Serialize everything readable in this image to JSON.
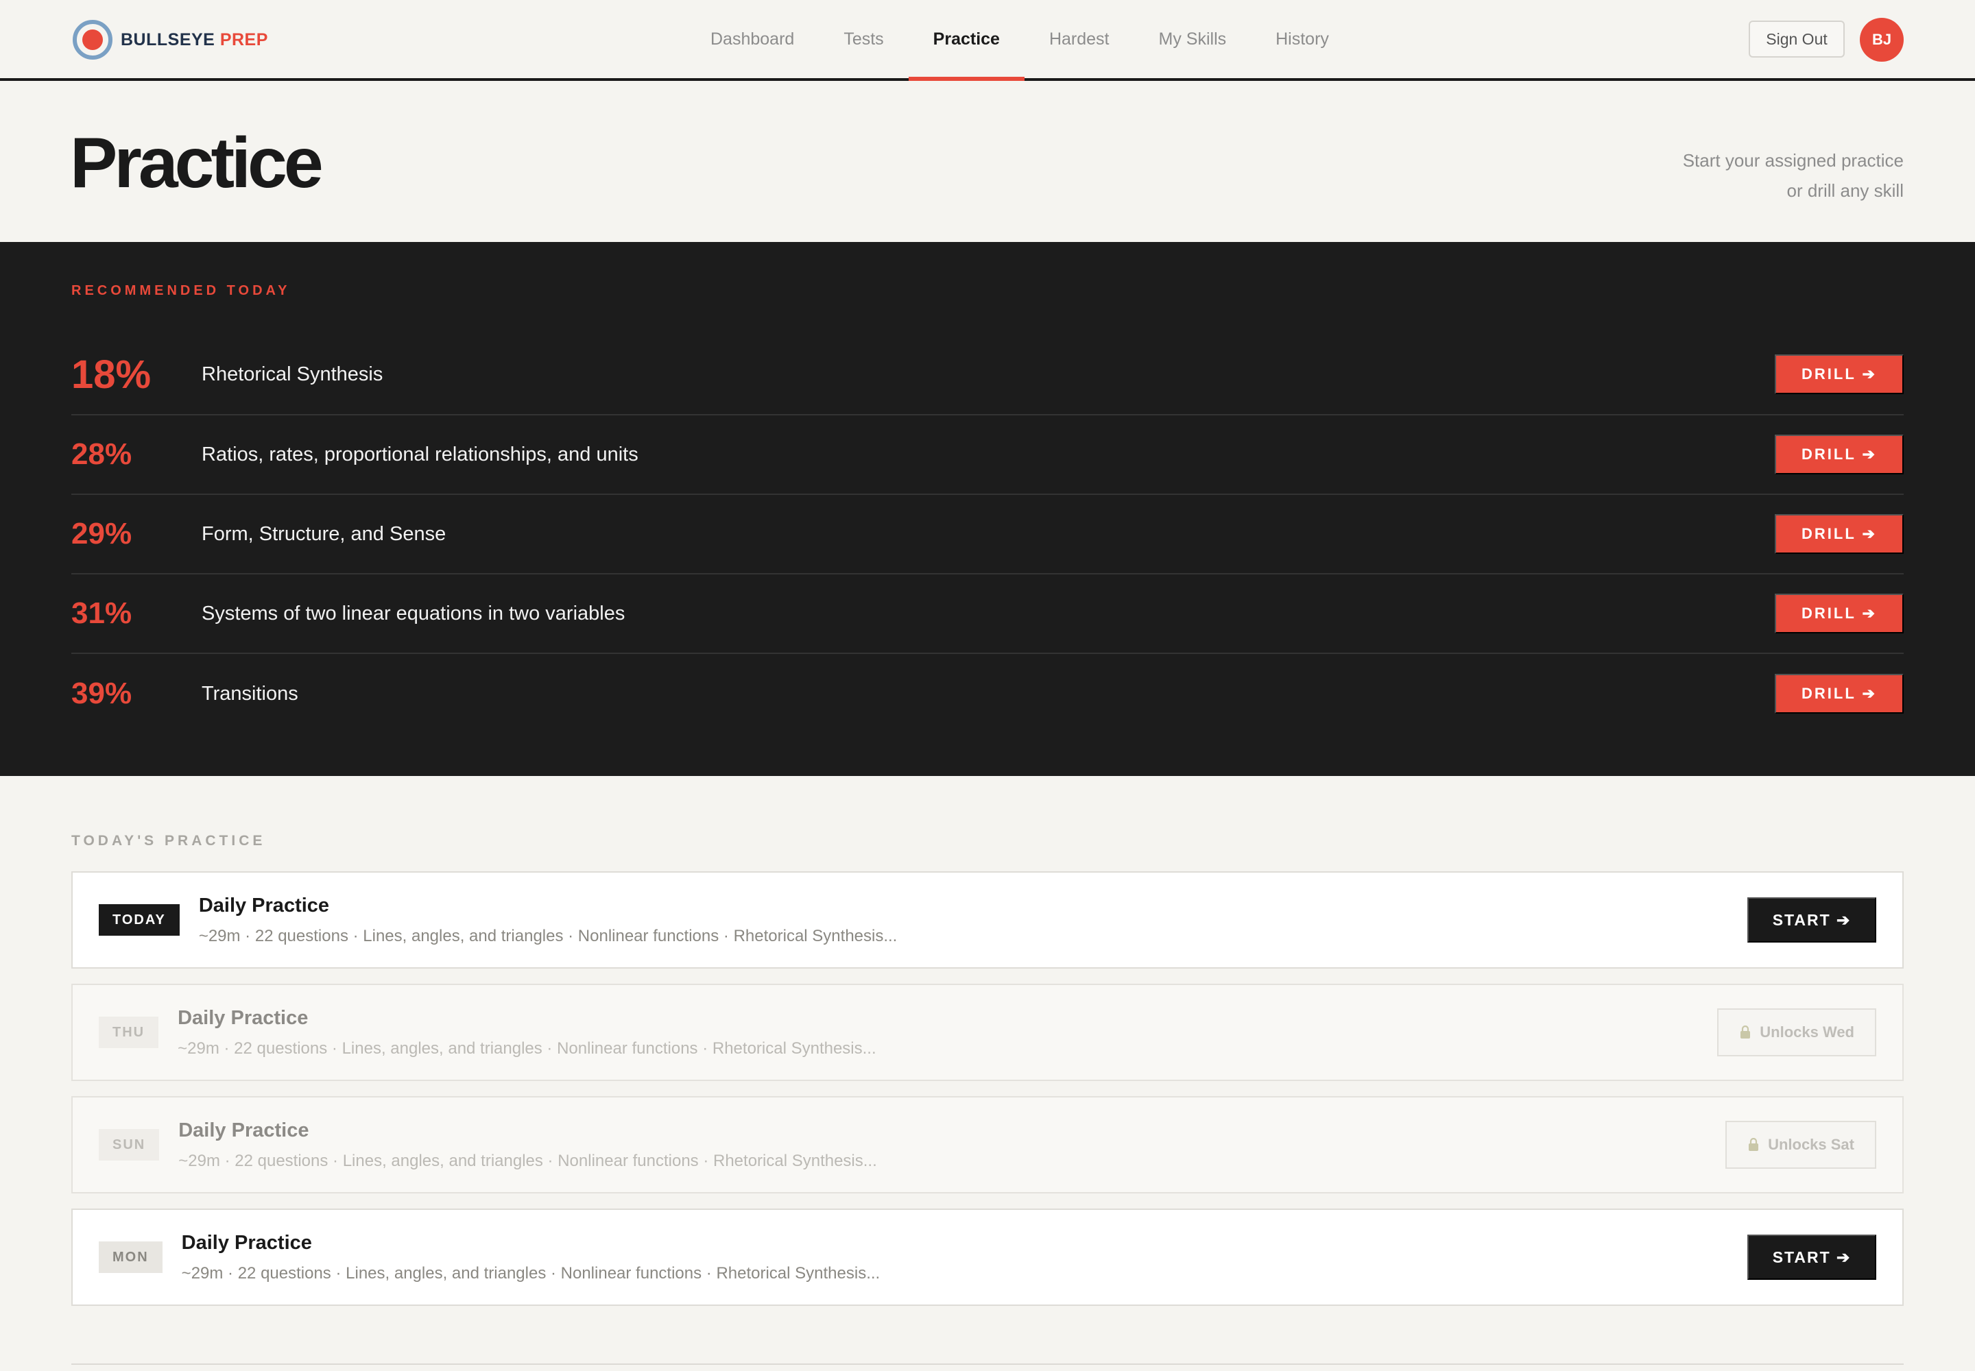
{
  "header": {
    "logo": {
      "part1": "BULLSEYE",
      "part2": "PREP",
      "icon": "bullseye-icon"
    },
    "nav": [
      {
        "label": "Dashboard",
        "active": false
      },
      {
        "label": "Tests",
        "active": false
      },
      {
        "label": "Practice",
        "active": true
      },
      {
        "label": "Hardest",
        "active": false
      },
      {
        "label": "My Skills",
        "active": false
      },
      {
        "label": "History",
        "active": false
      }
    ],
    "sign_out_label": "Sign Out",
    "avatar_initials": "BJ"
  },
  "page": {
    "title": "Practice",
    "subtitle_line1": "Start your assigned practice",
    "subtitle_line2": "or drill any skill"
  },
  "recommended": {
    "label": "RECOMMENDED TODAY",
    "items": [
      {
        "pct": "18%",
        "skill": "Rhetorical Synthesis",
        "button": "DRILL ➔"
      },
      {
        "pct": "28%",
        "skill": "Ratios, rates, proportional relationships, and units",
        "button": "DRILL ➔"
      },
      {
        "pct": "29%",
        "skill": "Form, Structure, and Sense",
        "button": "DRILL ➔"
      },
      {
        "pct": "31%",
        "skill": "Systems of two linear equations in two variables",
        "button": "DRILL ➔"
      },
      {
        "pct": "39%",
        "skill": "Transitions",
        "button": "DRILL ➔"
      }
    ]
  },
  "todays_practice": {
    "label": "TODAY'S PRACTICE",
    "cards": [
      {
        "day": "TODAY",
        "title": "Daily Practice",
        "meta": "~29m · 22 questions · Lines, angles, and triangles · Nonlinear functions · Rhetorical Synthesis...",
        "action": "START ➔",
        "locked": false
      },
      {
        "day": "THU",
        "title": "Daily Practice",
        "meta": "~29m · 22 questions · Lines, angles, and triangles · Nonlinear functions · Rhetorical Synthesis...",
        "action": "Unlocks Wed",
        "locked": true
      },
      {
        "day": "SUN",
        "title": "Daily Practice",
        "meta": "~29m · 22 questions · Lines, angles, and triangles · Nonlinear functions · Rhetorical Synthesis...",
        "action": "Unlocks Sat",
        "locked": true
      },
      {
        "day": "MON",
        "title": "Daily Practice",
        "meta": "~29m · 22 questions · Lines, angles, and triangles · Nonlinear functions · Rhetorical Synthesis...",
        "action": "START ➔",
        "locked": false
      }
    ]
  },
  "colors": {
    "accent": "#e8493a",
    "dark": "#1c1c1c",
    "background": "#f5f4f0",
    "logo_ring": "#7aa0c4"
  }
}
